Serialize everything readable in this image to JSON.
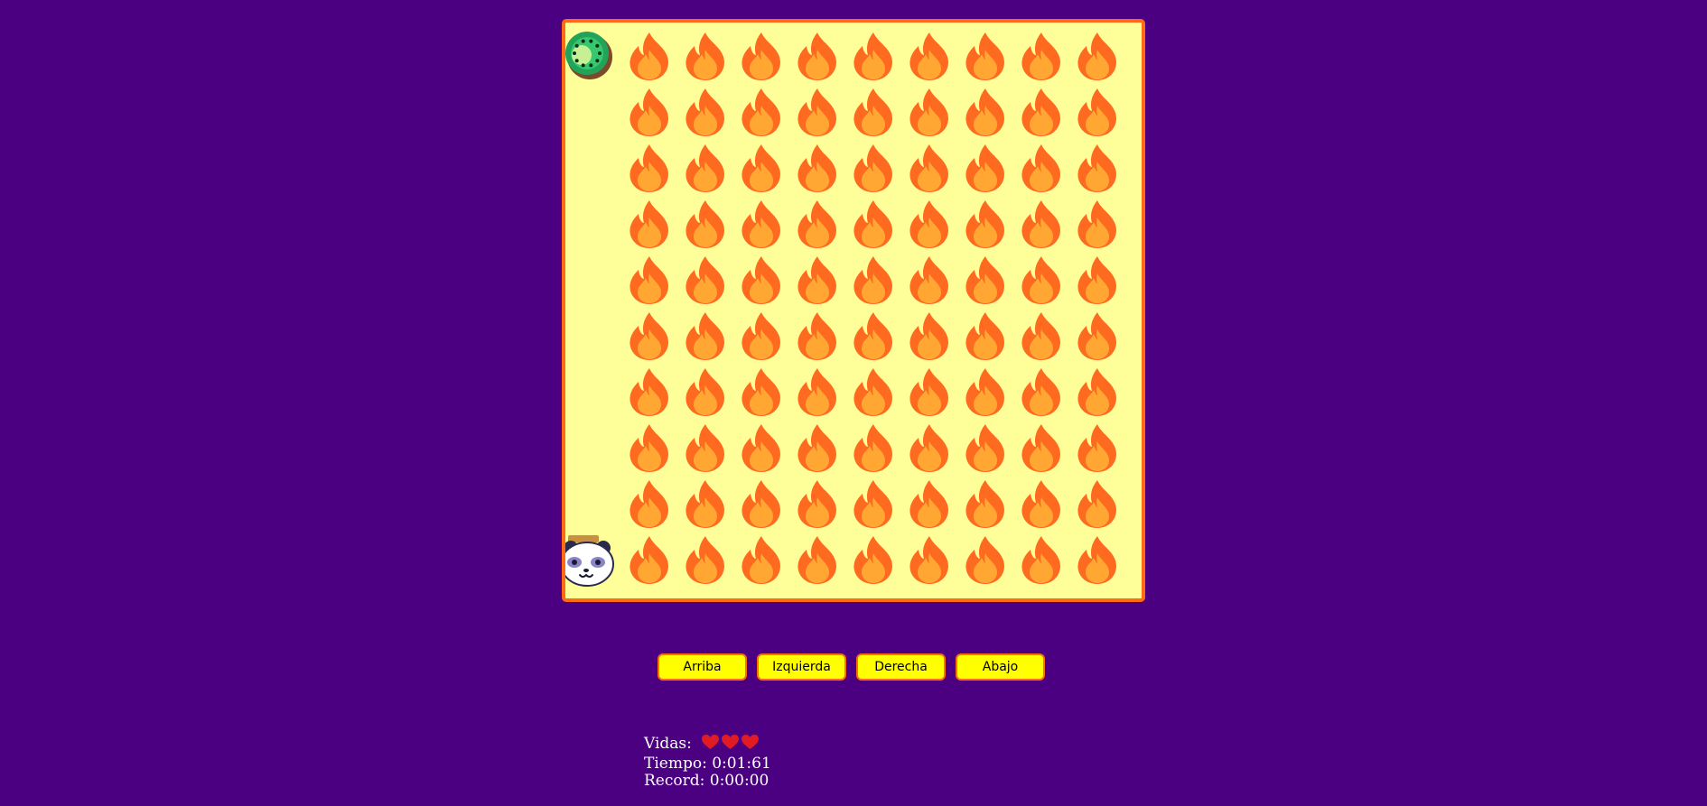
{
  "colors": {
    "background": "#4b0082",
    "board_fill": "#ffff99",
    "board_border": "#ff6a13",
    "button_fill": "#ffff00",
    "flame_outer": "#ff6a21",
    "flame_inner": "#ffa732",
    "heart": "#e01b24"
  },
  "board": {
    "columns": 10,
    "rows": 10,
    "cells": [
      [
        "kiwi",
        "fire",
        "fire",
        "fire",
        "fire",
        "fire",
        "fire",
        "fire",
        "fire",
        "fire"
      ],
      [
        "empty",
        "fire",
        "fire",
        "fire",
        "fire",
        "fire",
        "fire",
        "fire",
        "fire",
        "fire"
      ],
      [
        "empty",
        "fire",
        "fire",
        "fire",
        "fire",
        "fire",
        "fire",
        "fire",
        "fire",
        "fire"
      ],
      [
        "empty",
        "fire",
        "fire",
        "fire",
        "fire",
        "fire",
        "fire",
        "fire",
        "fire",
        "fire"
      ],
      [
        "empty",
        "fire",
        "fire",
        "fire",
        "fire",
        "fire",
        "fire",
        "fire",
        "fire",
        "fire"
      ],
      [
        "empty",
        "fire",
        "fire",
        "fire",
        "fire",
        "fire",
        "fire",
        "fire",
        "fire",
        "fire"
      ],
      [
        "empty",
        "fire",
        "fire",
        "fire",
        "fire",
        "fire",
        "fire",
        "fire",
        "fire",
        "fire"
      ],
      [
        "empty",
        "fire",
        "fire",
        "fire",
        "fire",
        "fire",
        "fire",
        "fire",
        "fire",
        "fire"
      ],
      [
        "empty",
        "fire",
        "fire",
        "fire",
        "fire",
        "fire",
        "fire",
        "fire",
        "fire",
        "fire"
      ],
      [
        "panda",
        "fire",
        "fire",
        "fire",
        "fire",
        "fire",
        "fire",
        "fire",
        "fire",
        "fire"
      ]
    ],
    "icons": {
      "fire": "fire-icon",
      "kiwi": "kiwi-icon",
      "panda": "panda-icon"
    }
  },
  "controls": {
    "up": "Arriba",
    "left": "Izquierda",
    "right": "Derecha",
    "down": "Abajo"
  },
  "status": {
    "lives_label": "Vidas:",
    "lives": 3,
    "heart_icon": "heart-icon",
    "time_label": "Tiempo:",
    "time_value": "0:01:61",
    "record_label": "Record:",
    "record_value": "0:00:00"
  }
}
